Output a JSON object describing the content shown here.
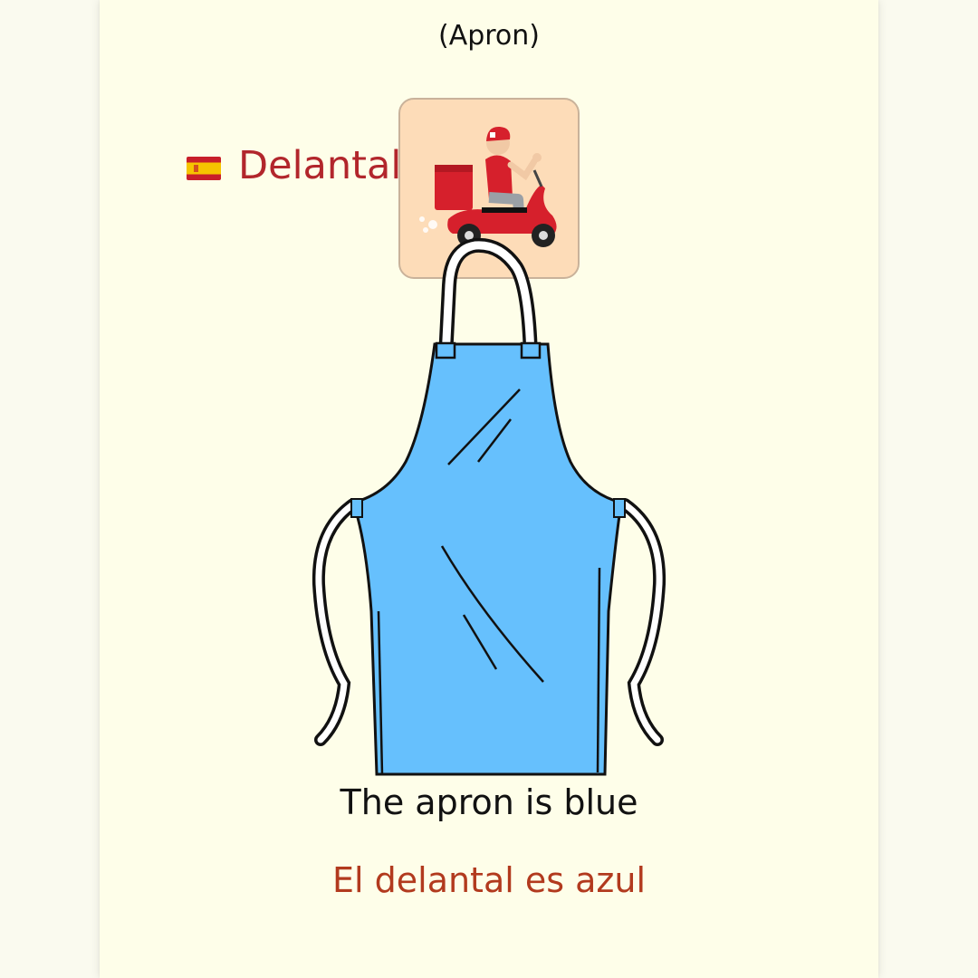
{
  "card": {
    "english_word": "(Apron)",
    "spanish_word": "Delantal",
    "flag_icon": "spain-flag-icon",
    "badge_icon": "delivery-scooter-icon",
    "illustration_icon": "apron-icon",
    "sentence_en": "The apron is blue",
    "sentence_es": "El delantal es azul"
  },
  "colors": {
    "background": "#fefee9",
    "spanish_word": "#b2262c",
    "spanish_sentence": "#b23a1e",
    "apron": "#66c0fd",
    "badge": "#fddcb8"
  }
}
